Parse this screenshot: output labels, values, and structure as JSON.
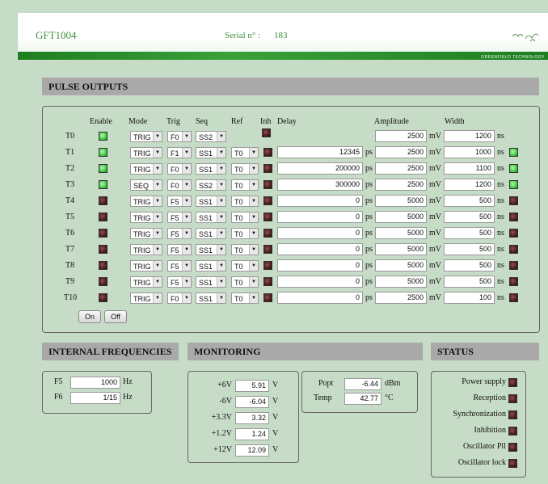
{
  "header": {
    "device": "GFT1004",
    "serial_label": "Serial n° :",
    "serial_value": "183",
    "brand": "GREENFIELD TECHNOLOGY"
  },
  "pulse": {
    "title": "PULSE OUTPUTS",
    "cols": {
      "enable": "Enable",
      "mode": "Mode",
      "trig": "Trig",
      "seq": "Seq",
      "ref": "Ref",
      "inh": "Inh",
      "delay": "Delay",
      "amplitude": "Amplitude",
      "width": "Width"
    },
    "units": {
      "delay": "ps",
      "amp": "mV",
      "width": "ns"
    },
    "rows": [
      {
        "name": "T0",
        "enable": true,
        "mode": "TRIG",
        "trig": "F0",
        "seq": "SS2",
        "ref": null,
        "inh": false,
        "delay": null,
        "amp": "2500",
        "width": "1200",
        "status": null
      },
      {
        "name": "T1",
        "enable": true,
        "mode": "TRIG",
        "trig": "F1",
        "seq": "SS1",
        "ref": "T0",
        "inh": false,
        "delay": "12345",
        "amp": "2500",
        "width": "1000",
        "status": true
      },
      {
        "name": "T2",
        "enable": true,
        "mode": "TRIG",
        "trig": "F0",
        "seq": "SS1",
        "ref": "T0",
        "inh": false,
        "delay": "200000",
        "amp": "2500",
        "width": "1100",
        "status": true
      },
      {
        "name": "T3",
        "enable": true,
        "mode": "SEQ",
        "trig": "F0",
        "seq": "SS2",
        "ref": "T0",
        "inh": false,
        "delay": "300000",
        "amp": "2500",
        "width": "1200",
        "status": true
      },
      {
        "name": "T4",
        "enable": false,
        "mode": "TRIG",
        "trig": "F5",
        "seq": "SS1",
        "ref": "T0",
        "inh": false,
        "delay": "0",
        "amp": "5000",
        "width": "500",
        "status": false
      },
      {
        "name": "T5",
        "enable": false,
        "mode": "TRIG",
        "trig": "F5",
        "seq": "SS1",
        "ref": "T0",
        "inh": false,
        "delay": "0",
        "amp": "5000",
        "width": "500",
        "status": false
      },
      {
        "name": "T6",
        "enable": false,
        "mode": "TRIG",
        "trig": "F5",
        "seq": "SS1",
        "ref": "T0",
        "inh": false,
        "delay": "0",
        "amp": "5000",
        "width": "500",
        "status": false
      },
      {
        "name": "T7",
        "enable": false,
        "mode": "TRIG",
        "trig": "F5",
        "seq": "SS1",
        "ref": "T0",
        "inh": false,
        "delay": "0",
        "amp": "5000",
        "width": "500",
        "status": false
      },
      {
        "name": "T8",
        "enable": false,
        "mode": "TRIG",
        "trig": "F5",
        "seq": "SS1",
        "ref": "T0",
        "inh": false,
        "delay": "0",
        "amp": "5000",
        "width": "500",
        "status": false
      },
      {
        "name": "T9",
        "enable": false,
        "mode": "TRIG",
        "trig": "F5",
        "seq": "SS1",
        "ref": "T0",
        "inh": false,
        "delay": "0",
        "amp": "5000",
        "width": "500",
        "status": false
      },
      {
        "name": "T10",
        "enable": false,
        "mode": "TRIG",
        "trig": "F0",
        "seq": "SS1",
        "ref": "T0",
        "inh": false,
        "delay": "0",
        "amp": "2500",
        "width": "100",
        "status": false
      }
    ],
    "on_label": "On",
    "off_label": "Off"
  },
  "freq": {
    "title": "INTERNAL FREQUENCIES",
    "unit": "Hz",
    "items": [
      {
        "label": "F5",
        "value": "1000"
      },
      {
        "label": "F6",
        "value": "1/15"
      }
    ]
  },
  "monitoring": {
    "title": "MONITORING",
    "voltages": [
      {
        "label": "+6V",
        "value": "5.91"
      },
      {
        "label": "-6V",
        "value": "-6.04"
      },
      {
        "label": "+3.3V",
        "value": "3.32"
      },
      {
        "label": "+1.2V",
        "value": "1.24"
      },
      {
        "label": "+12V",
        "value": "12.09"
      }
    ],
    "v_unit": "V",
    "popt": {
      "label": "Popt",
      "value": "-6.44",
      "unit": "dBm"
    },
    "temp": {
      "label": "Temp",
      "value": "42.77",
      "unit": "°C"
    }
  },
  "status": {
    "title": "STATUS",
    "items": [
      "Power supply",
      "Reception",
      "Synchronization",
      "Inhibition",
      "Oscillator Pll",
      "Oscillator lock"
    ]
  }
}
